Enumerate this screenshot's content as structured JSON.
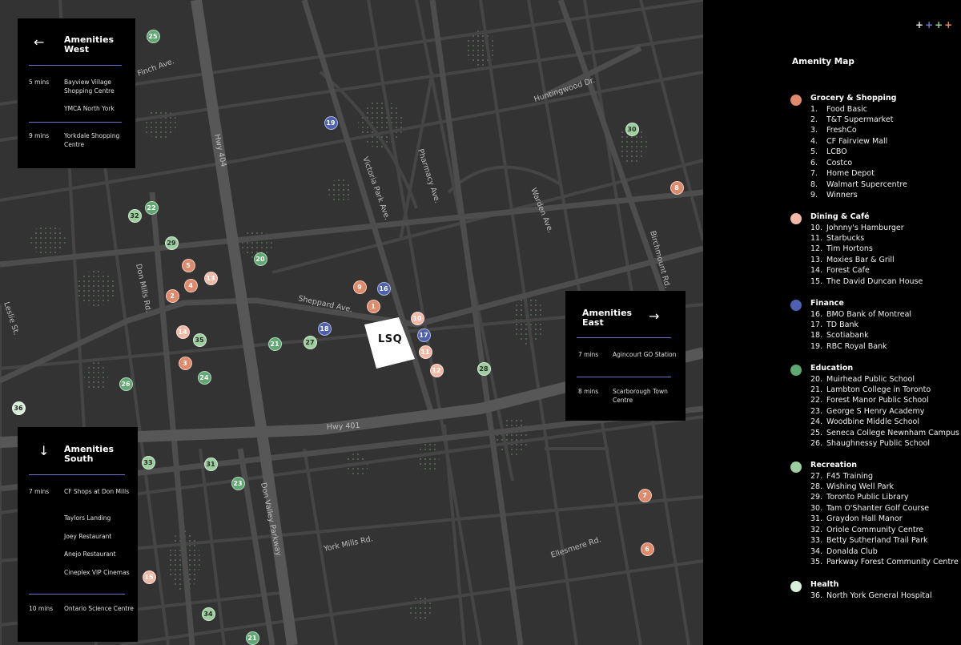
{
  "colors": {
    "grocery": "#e08a6c",
    "dining": "#f1b8a6",
    "finance": "#4d61b0",
    "education": "#5fa871",
    "recreation": "#9ccf9d",
    "health": "#d8f0da",
    "panel_rule": "#6d74c8",
    "plus_1": "#e0e0e0",
    "plus_2": "#6d74c8",
    "plus_3": "#9ccf9d",
    "plus_4": "#e08a6c"
  },
  "header": {
    "plus_icons": [
      "+",
      "+",
      "+",
      "+"
    ]
  },
  "map": {
    "roads": [
      "Finch Ave.",
      "Huntingwood Dr.",
      "Hwy 404",
      "Victoria Park Ave.",
      "Pharmacy Ave.",
      "Warden Ave.",
      "Birchmount Rd.",
      "Don Mills Rd.",
      "Sheppard Ave.",
      "Leslie St.",
      "Hwy 401",
      "Don Valley Parkway",
      "York Mills Rd.",
      "Ellesmere Rd."
    ],
    "site_label": "LSQ",
    "markers": [
      {
        "n": "1",
        "cat": "grocery"
      },
      {
        "n": "2",
        "cat": "grocery"
      },
      {
        "n": "3",
        "cat": "grocery"
      },
      {
        "n": "4",
        "cat": "grocery"
      },
      {
        "n": "5",
        "cat": "grocery"
      },
      {
        "n": "6",
        "cat": "grocery"
      },
      {
        "n": "7",
        "cat": "grocery"
      },
      {
        "n": "8",
        "cat": "grocery"
      },
      {
        "n": "9",
        "cat": "grocery"
      },
      {
        "n": "10",
        "cat": "dining"
      },
      {
        "n": "11",
        "cat": "dining"
      },
      {
        "n": "12",
        "cat": "dining"
      },
      {
        "n": "13",
        "cat": "dining"
      },
      {
        "n": "14",
        "cat": "dining"
      },
      {
        "n": "15",
        "cat": "dining"
      },
      {
        "n": "16",
        "cat": "finance"
      },
      {
        "n": "17",
        "cat": "finance"
      },
      {
        "n": "18",
        "cat": "finance"
      },
      {
        "n": "19",
        "cat": "finance"
      },
      {
        "n": "20",
        "cat": "education"
      },
      {
        "n": "21",
        "cat": "education"
      },
      {
        "n": "21",
        "cat": "education"
      },
      {
        "n": "22",
        "cat": "education"
      },
      {
        "n": "23",
        "cat": "education"
      },
      {
        "n": "24",
        "cat": "education"
      },
      {
        "n": "25",
        "cat": "education"
      },
      {
        "n": "26",
        "cat": "education"
      },
      {
        "n": "27",
        "cat": "recreation"
      },
      {
        "n": "28",
        "cat": "recreation"
      },
      {
        "n": "29",
        "cat": "recreation"
      },
      {
        "n": "30",
        "cat": "recreation"
      },
      {
        "n": "31",
        "cat": "recreation"
      },
      {
        "n": "32",
        "cat": "recreation"
      },
      {
        "n": "33",
        "cat": "recreation"
      },
      {
        "n": "34",
        "cat": "recreation"
      },
      {
        "n": "35",
        "cat": "recreation"
      },
      {
        "n": "36",
        "cat": "health"
      }
    ]
  },
  "panels": {
    "west": {
      "title_line1": "Amenities",
      "title_line2": "West",
      "arrow": "←",
      "rows": [
        {
          "time": "5 mins",
          "place": "Bayview Village Shopping Centre"
        },
        {
          "time": "",
          "place": "YMCA North York"
        },
        {
          "time": "9 mins",
          "place": "Yorkdale Shopping Centre"
        }
      ]
    },
    "east": {
      "title_line1": "Amenities",
      "title_line2": "East",
      "arrow": "→",
      "rows": [
        {
          "time": "7 mins",
          "place": "Agincourt GO Station"
        },
        {
          "time": "8 mins",
          "place": "Scarborough Town Centre"
        }
      ]
    },
    "south": {
      "title_line1": "Amenities",
      "title_line2": "South",
      "arrow": "↓",
      "rows": [
        {
          "time": "7 mins",
          "place": "CF Shops at Don Mills"
        },
        {
          "time": "",
          "place": "Taylors Landing"
        },
        {
          "time": "",
          "place": "Joey Restaurant"
        },
        {
          "time": "",
          "place": "Anejo Restaurant"
        },
        {
          "time": "",
          "place": "Cineplex VIP Cinemas"
        },
        {
          "time": "10 mins",
          "place": "Ontario Science Centre"
        }
      ]
    }
  },
  "legend": {
    "title": "Amenity Map",
    "categories": [
      {
        "key": "grocery",
        "name": "Grocery & Shopping",
        "items": [
          {
            "num": "1.",
            "label": "Food Basic"
          },
          {
            "num": "2.",
            "label": "T&T Supermarket"
          },
          {
            "num": "3.",
            "label": "FreshCo"
          },
          {
            "num": "4.",
            "label": "CF Fairview Mall"
          },
          {
            "num": "5.",
            "label": "LCBO"
          },
          {
            "num": "6.",
            "label": "Costco"
          },
          {
            "num": "7.",
            "label": "Home Depot"
          },
          {
            "num": "8.",
            "label": "Walmart Supercentre"
          },
          {
            "num": "9.",
            "label": "Winners"
          }
        ]
      },
      {
        "key": "dining",
        "name": "Dining & Café",
        "items": [
          {
            "num": "10.",
            "label": "Johnny's Hamburger"
          },
          {
            "num": "11.",
            "label": "Starbucks"
          },
          {
            "num": "12.",
            "label": "Tim Hortons"
          },
          {
            "num": "13.",
            "label": "Moxies Bar & Grill"
          },
          {
            "num": "14.",
            "label": "Forest Cafe"
          },
          {
            "num": "15.",
            "label": "The David Duncan House"
          }
        ]
      },
      {
        "key": "finance",
        "name": "Finance",
        "items": [
          {
            "num": "16.",
            "label": "BMO Bank of Montreal"
          },
          {
            "num": "17.",
            "label": "TD Bank"
          },
          {
            "num": "18.",
            "label": "Scotiabank"
          },
          {
            "num": "19.",
            "label": "RBC Royal Bank"
          }
        ]
      },
      {
        "key": "education",
        "name": "Education",
        "items": [
          {
            "num": "20.",
            "label": "Muirhead Public School"
          },
          {
            "num": "21.",
            "label": "Lambton College in Toronto"
          },
          {
            "num": "22.",
            "label": "Forest Manor Public School"
          },
          {
            "num": "23.",
            "label": "George S Henry Academy"
          },
          {
            "num": "24.",
            "label": "Woodbine Middle School"
          },
          {
            "num": "25.",
            "label": "Seneca College Newnham Campus"
          },
          {
            "num": "26.",
            "label": "Shaughnessy Public School"
          }
        ]
      },
      {
        "key": "recreation",
        "name": "Recreation",
        "items": [
          {
            "num": "27.",
            "label": "F45 Training"
          },
          {
            "num": "28.",
            "label": "Wishing Well Park"
          },
          {
            "num": "29.",
            "label": "Toronto Public Library"
          },
          {
            "num": "30.",
            "label": "Tam O'Shanter Golf Course"
          },
          {
            "num": "31.",
            "label": "Graydon Hall Manor"
          },
          {
            "num": "32.",
            "label": "Oriole Community Centre"
          },
          {
            "num": "33.",
            "label": "Betty Sutherland Trail Park"
          },
          {
            "num": "34.",
            "label": "Donalda Club"
          },
          {
            "num": "35.",
            "label": "Parkway Forest Community Centre"
          }
        ]
      },
      {
        "key": "health",
        "name": "Health",
        "items": [
          {
            "num": "36.",
            "label": "North York General Hospital"
          }
        ]
      }
    ]
  }
}
